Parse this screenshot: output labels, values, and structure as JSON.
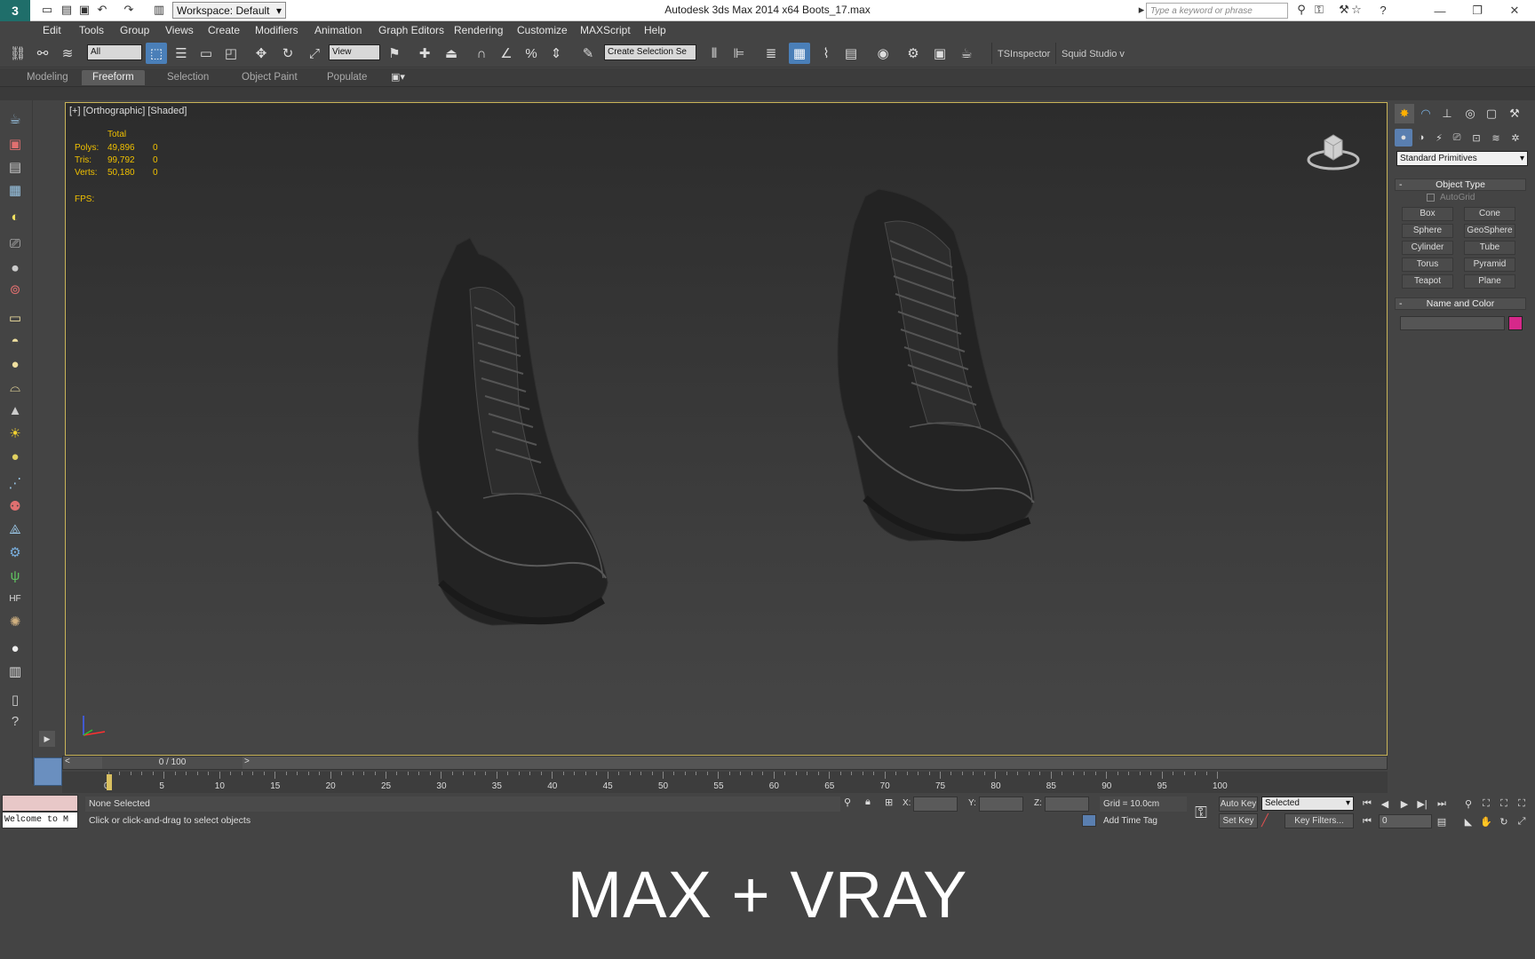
{
  "titlebar": {
    "workspace": "Workspace: Default",
    "app_title": "Autodesk 3ds Max  2014 x64      Boots_17.max",
    "search_placeholder": "Type a keyword or phrase"
  },
  "menu": [
    "Edit",
    "Tools",
    "Group",
    "Views",
    "Create",
    "Modifiers",
    "Animation",
    "Graph Editors",
    "Rendering",
    "Customize",
    "MAXScript",
    "Help"
  ],
  "toolbar": {
    "filter": "All",
    "ref_coord": "View",
    "selection_set": "Create Selection Se",
    "ts_inspector": "TSInspector",
    "squid": "Squid Studio v"
  },
  "ribbon_tabs": [
    "Modeling",
    "Freeform",
    "Selection",
    "Object Paint",
    "Populate"
  ],
  "ribbon_active": "Freeform",
  "viewport": {
    "label": "[+] [Orthographic] [Shaded]",
    "stats_header": "Total",
    "stats": [
      {
        "label": "Polys:",
        "total": "49,896",
        "sel": "0"
      },
      {
        "label": "Tris:",
        "total": "99,792",
        "sel": "0"
      },
      {
        "label": "Verts:",
        "total": "50,180",
        "sel": "0"
      }
    ],
    "fps": "FPS:"
  },
  "command_panel": {
    "primitive_type": "Standard Primitives",
    "object_type_title": "Object Type",
    "autogrid": "AutoGrid",
    "buttons": [
      "Box",
      "Cone",
      "Sphere",
      "GeoSphere",
      "Cylinder",
      "Tube",
      "Torus",
      "Pyramid",
      "Teapot",
      "Plane"
    ],
    "name_color_title": "Name and Color",
    "object_color": "#d6288a"
  },
  "timeline": {
    "slider": "0 / 100",
    "ticks": [
      "0",
      "5",
      "10",
      "15",
      "20",
      "25",
      "30",
      "35",
      "40",
      "45",
      "50",
      "55",
      "60",
      "65",
      "70",
      "75",
      "80",
      "85",
      "90",
      "95",
      "100"
    ]
  },
  "status": {
    "maxscript_out": "Welcome to M",
    "selection": "None Selected",
    "prompt": "Click or click-and-drag to select objects",
    "x": "X:",
    "y": "Y:",
    "z": "Z:",
    "grid": "Grid = 10.0cm",
    "add_time_tag": "Add Time Tag",
    "auto_key": "Auto Key",
    "set_key": "Set Key",
    "key_mode": "Selected",
    "key_filters": "Key Filters...",
    "frame": "0"
  },
  "caption": "MAX + VRAY"
}
